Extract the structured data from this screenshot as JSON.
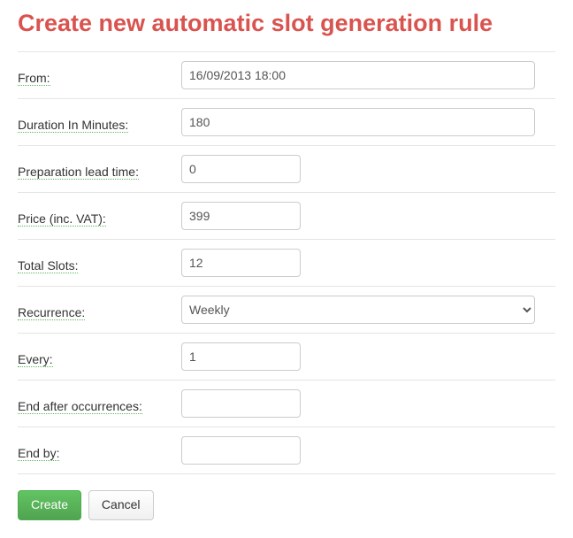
{
  "title": "Create new automatic slot generation rule",
  "fields": {
    "from": {
      "label": "From:",
      "value": "16/09/2013 18:00"
    },
    "duration": {
      "label": "Duration In Minutes:",
      "value": "180"
    },
    "prep": {
      "label": "Preparation lead time:",
      "value": "0"
    },
    "price": {
      "label": "Price (inc. VAT):",
      "value": "399"
    },
    "total": {
      "label": "Total Slots:",
      "value": "12"
    },
    "recurrence": {
      "label": "Recurrence:",
      "value": "Weekly"
    },
    "every": {
      "label": "Every:",
      "value": "1"
    },
    "endocc": {
      "label": "End after occurrences:",
      "value": ""
    },
    "endby": {
      "label": "End by:",
      "value": ""
    }
  },
  "buttons": {
    "create": "Create",
    "cancel": "Cancel"
  }
}
